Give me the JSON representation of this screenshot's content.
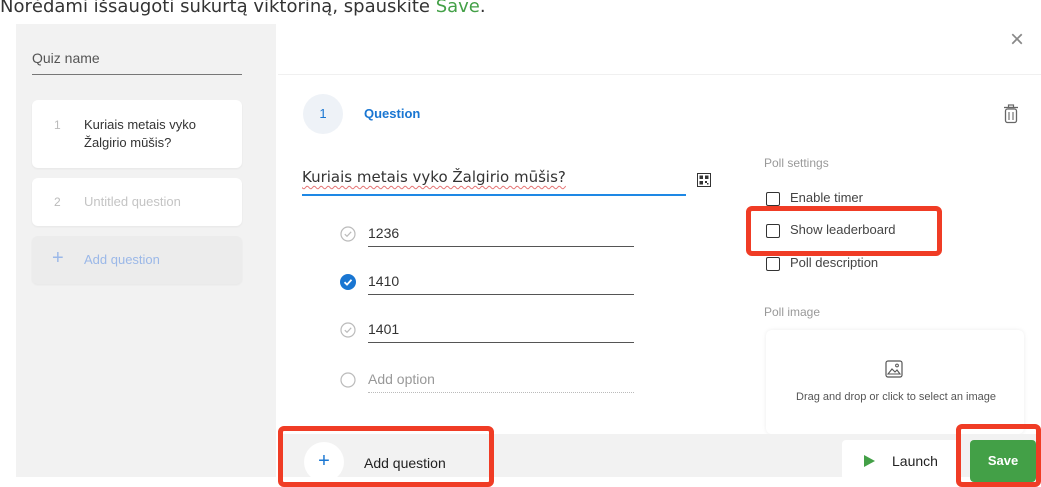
{
  "instruction": {
    "prefix": "Norėdami išsaugoti sukurtą viktoriną, spauskite ",
    "highlight": "Save",
    "suffix": "."
  },
  "sidebar": {
    "quiz_name_placeholder": "Quiz name",
    "questions": [
      {
        "number": "1",
        "title": "Kuriais metais vyko Žalgirio mūšis?"
      },
      {
        "number": "2",
        "title": "Untitled question"
      }
    ],
    "add_question_label": "Add question"
  },
  "question": {
    "number": "1",
    "label": "Question",
    "text": "Kuriais metais vyko Žalgirio mūšis?",
    "options": [
      {
        "value": "1236",
        "correct": false
      },
      {
        "value": "1410",
        "correct": true
      },
      {
        "value": "1401",
        "correct": false
      }
    ],
    "add_option_placeholder": "Add option"
  },
  "poll_settings": {
    "title": "Poll settings",
    "enable_timer": "Enable timer",
    "show_leaderboard": "Show leaderboard",
    "poll_description": "Poll description"
  },
  "poll_image": {
    "title": "Poll image",
    "dropzone_text": "Drag and drop or click to select an image"
  },
  "footer": {
    "add_question_label": "Add question",
    "add_icon": "+",
    "launch_label": "Launch",
    "save_label": "Save"
  },
  "close_icon": "×",
  "colors": {
    "accent_blue": "#1976d2",
    "save_green": "#43a047",
    "highlight_red": "#f03c25"
  }
}
